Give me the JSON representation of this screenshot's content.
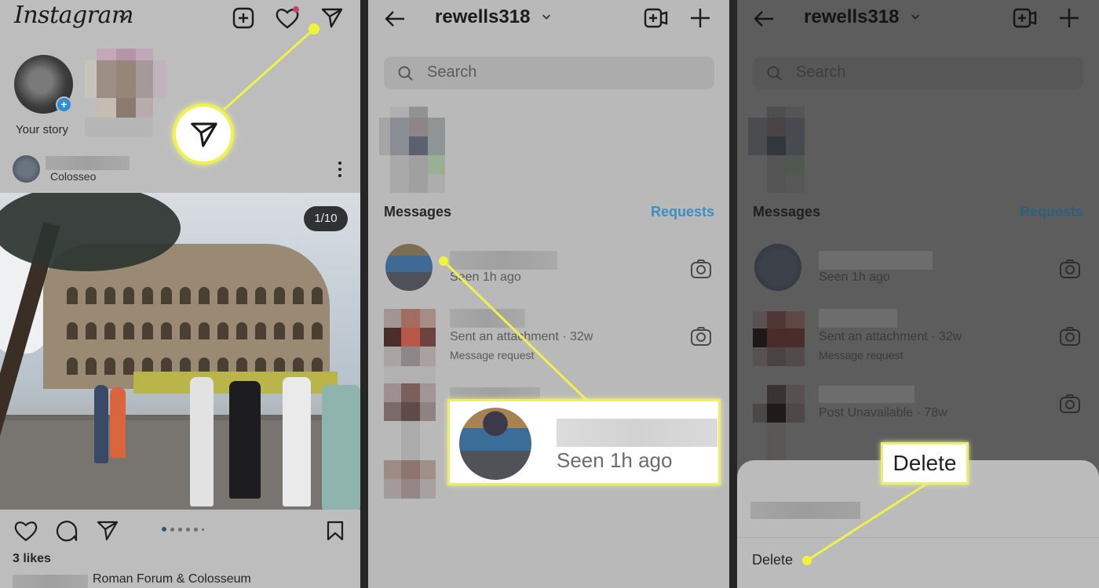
{
  "feed": {
    "app_name": "Instagram",
    "icons": [
      "new-post-icon",
      "heart-icon",
      "direct-message-icon"
    ],
    "notification_color": "#d4375f",
    "story": {
      "label": "Your story"
    },
    "post": {
      "location": "Colosseo",
      "carousel_counter": "1/10",
      "carousel_position": 1,
      "carousel_total": 10,
      "likes": "3 likes",
      "caption": "Roman Forum & Colosseum"
    },
    "highlight_icon": "direct-message-icon"
  },
  "inbox": {
    "username": "rewells318",
    "search_placeholder": "Search",
    "messages_label": "Messages",
    "requests_label": "Requests",
    "accent_color": "#3c8fbf",
    "threads": [
      {
        "subtitle": "Seen 1h ago",
        "extra": ""
      },
      {
        "subtitle": "Sent an attachment · 32w",
        "extra": "Message request"
      },
      {
        "subtitle": "Post Unavailable · 78w",
        "extra": ""
      }
    ],
    "callout_text": "Seen 1h ago"
  },
  "delete_panel": {
    "username": "rewells318",
    "search_placeholder": "Search",
    "messages_label": "Messages",
    "requests_label": "Requests",
    "threads": [
      {
        "subtitle": "Seen 1h ago",
        "extra": ""
      },
      {
        "subtitle": "Sent an attachment · 32w",
        "extra": "Message request"
      },
      {
        "subtitle": "Post Unavailable · 78w",
        "extra": ""
      }
    ],
    "sheet_option": "Delete",
    "callout_text": "Delete"
  },
  "highlight_color": "#f1f53a"
}
